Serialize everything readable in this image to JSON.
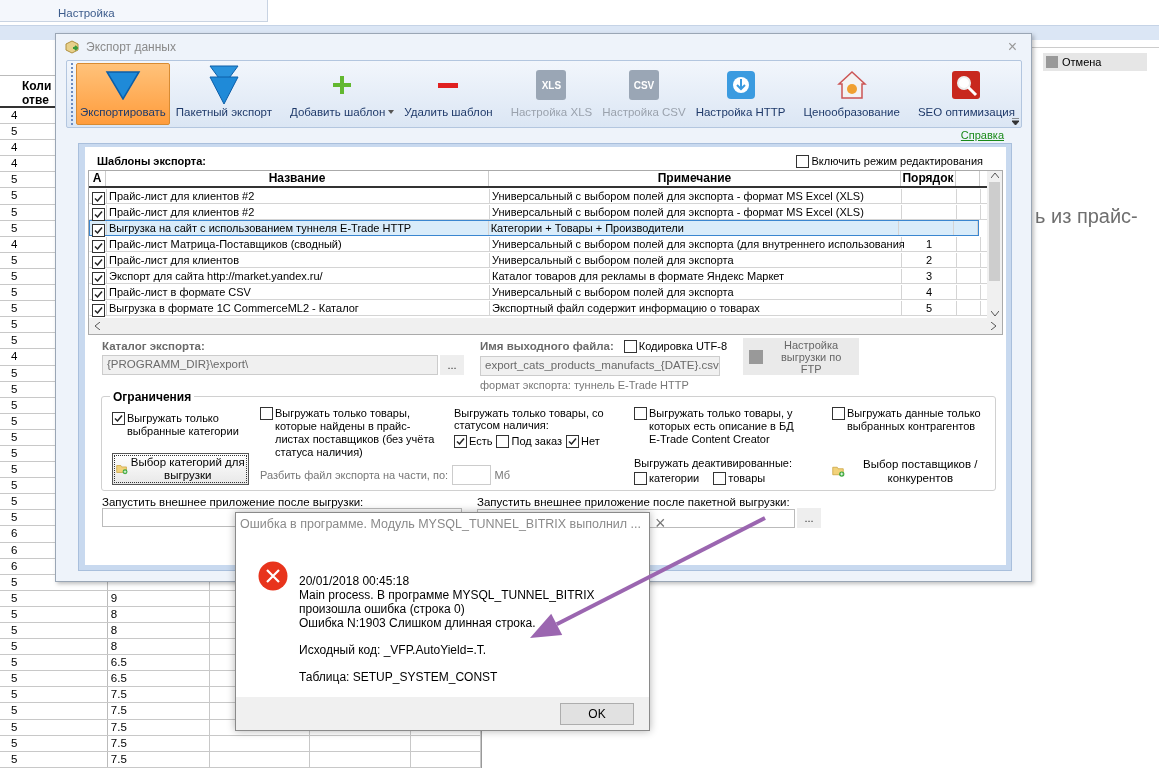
{
  "background_app": {
    "ribbon_group": "Настройка",
    "grid": {
      "header": "Коли отве",
      "rows": [
        {
          "column_1": "4"
        },
        {
          "column_1": "5"
        },
        {
          "column_1": "4"
        },
        {
          "column_1": "4"
        },
        {
          "column_1": "5"
        },
        {
          "column_1": "5"
        },
        {
          "column_1": "5"
        },
        {
          "column_1": "5"
        },
        {
          "column_1": "4"
        },
        {
          "column_1": "5"
        },
        {
          "column_1": "5"
        },
        {
          "column_1": "5"
        },
        {
          "column_1": "5"
        },
        {
          "column_1": "5"
        },
        {
          "column_1": "5"
        },
        {
          "column_1": "4"
        },
        {
          "column_1": "5"
        },
        {
          "column_1": "5"
        },
        {
          "column_1": "5"
        },
        {
          "column_1": "5"
        },
        {
          "column_1": "5"
        },
        {
          "column_1": "5"
        },
        {
          "column_1": "5"
        },
        {
          "column_1": "5"
        },
        {
          "column_1": "5"
        },
        {
          "column_1": "5"
        },
        {
          "column_1": "6"
        },
        {
          "column_1": "6"
        },
        {
          "column_1": "6"
        },
        {
          "column_1": "5"
        },
        {
          "column_1": "5",
          "column_2": "9"
        },
        {
          "column_1": "5",
          "column_2": "8"
        },
        {
          "column_1": "5",
          "column_2": "8"
        },
        {
          "column_1": "5",
          "column_2": "8"
        },
        {
          "column_1": "5",
          "column_2": "6.5"
        },
        {
          "column_1": "5",
          "column_2": "6.5"
        },
        {
          "column_1": "5",
          "column_2": "7.5"
        },
        {
          "column_1": "5",
          "column_2": "7.5"
        },
        {
          "column_1": "5",
          "column_2": "7.5"
        },
        {
          "column_1": "5",
          "column_2": "7.5"
        },
        {
          "column_1": "5",
          "column_2": "7.5"
        }
      ]
    },
    "cancel_button": "Отмена",
    "side_text": "ь из прайс-"
  },
  "export_window": {
    "title": "Экспорт данных",
    "close": "×",
    "toolbar": {
      "groups": [
        [
          {
            "label": "Экспортировать",
            "selected": true,
            "disabled": false
          },
          {
            "label": "Пакетный экспорт",
            "selected": false,
            "disabled": false
          }
        ],
        [
          {
            "label": "Добавить шаблон",
            "selected": false,
            "disabled": false,
            "dropdown": true
          },
          {
            "label": "Удалить шаблон",
            "selected": false,
            "disabled": false
          }
        ],
        [
          {
            "label": "Настройка XLS",
            "icon_text": "XLS",
            "selected": false,
            "disabled": true
          },
          {
            "label": "Настройка CSV",
            "icon_text": "CSV",
            "selected": false,
            "disabled": true
          },
          {
            "label": "Настройка HTTP",
            "selected": false,
            "disabled": false
          }
        ],
        [
          {
            "label": "Ценообразование",
            "selected": false,
            "disabled": false
          }
        ],
        [
          {
            "label": "SEO оптимизация",
            "selected": false,
            "disabled": false
          }
        ]
      ]
    },
    "help_link": "Справка",
    "templates": {
      "title": "Шаблоны экспорта:",
      "edit_mode": {
        "label": "Включить режим редактирования",
        "checked": false
      },
      "columns": [
        "А",
        "Название",
        "Примечание",
        "Порядок"
      ],
      "rows": [
        {
          "active": true,
          "name": "Прайс-лист для клиентов #2",
          "note": "Универсальный с выбором полей для экспорта - формат MS Excel (XLS)",
          "selected": false
        },
        {
          "active": true,
          "name": "Прайс-лист для клиентов #2",
          "note": "Универсальный с выбором полей для экспорта - формат MS Excel (XLS)",
          "selected": false
        },
        {
          "active": true,
          "name": "Выгрузка на сайт с использованием туннеля E-Trade HTTP",
          "note": "Категории + Товары + Производители",
          "selected": true
        },
        {
          "active": true,
          "name": "Прайс-лист Матрица-Поставщиков (сводный)",
          "note": "Универсальный с выбором полей для экспорта (для внутреннего использования",
          "order": "1",
          "selected": false
        },
        {
          "active": true,
          "name": "Прайс-лист для клиентов",
          "note": "Универсальный с выбором полей для экспорта",
          "order": "2",
          "selected": false
        },
        {
          "active": true,
          "name": "Экспорт для сайта http://market.yandex.ru/",
          "note": "Каталог товаров для рекламы в формате Яндекс Маркет",
          "order": "3",
          "selected": false
        },
        {
          "active": true,
          "name": "Прайс-лист в формате CSV",
          "note": "Универсальный с выбором полей для экспорта",
          "order": "4",
          "selected": false
        },
        {
          "active": true,
          "name": "Выгрузка в формате 1С CommerceML2 - Каталог",
          "note": "Экспортный файл содержит информацию о товарах",
          "order": "5",
          "selected": false
        }
      ]
    },
    "export_dir": {
      "label": "Каталог экспорта:",
      "value": "{PROGRAMM_DIR}\\export\\",
      "browse": "...",
      "disabled": true
    },
    "output_file": {
      "label": "Имя выходного файла:",
      "value": "export_cats_products_manufacts_{DATE}.csv",
      "disabled": true,
      "hint": "формат экспорта: туннель E-Trade HTTP"
    },
    "utf8": {
      "label": "Кодировка UTF-8",
      "checked": false
    },
    "ftp_button": {
      "label": "Настройка выгрузки по FTP",
      "disabled": true
    },
    "restrictions": {
      "title": "Ограничения",
      "selected_categories": {
        "label": "Выгружать только выбранные категории",
        "checked": true
      },
      "categories_button": "Выбор категорий для выгрузки",
      "supplier_found": {
        "label": "Выгружать только товары, которые найдены в прайс-листах поставщиков (без учёта статуса наличия)",
        "checked": false
      },
      "split_label": "Разбить файл экспорта на части, по:",
      "split_unit": "Мб",
      "status_label": "Выгружать только товары, со статусом наличия:",
      "statuses": [
        {
          "label": "Есть",
          "checked": true
        },
        {
          "label": "Под заказ",
          "checked": false
        },
        {
          "label": "Нет",
          "checked": true
        }
      ],
      "with_description": {
        "label": "Выгружать только товары, у которых есть описание в БД E-Trade Content Creator",
        "checked": false
      },
      "deactivated_label": "Выгружать деактивированные:",
      "deactivated": [
        {
          "label": "категории",
          "checked": false
        },
        {
          "label": "товары",
          "checked": false
        }
      ],
      "selected_partners": {
        "label": "Выгружать данные только выбранных контрагентов",
        "checked": false
      },
      "suppliers_button": "Выбор поставщиков / конкурентов"
    },
    "run_after": {
      "label": "Запустить внешнее приложение после выгрузки:"
    },
    "run_after_batch": {
      "label": "Запустить внешнее приложение после пакетной выгрузки:",
      "browse": "..."
    }
  },
  "error_dialog": {
    "title": "Ошибка в программе. Модуль MYSQL_TUNNEL_BITRIX выполнил ...",
    "close": "×",
    "paragraphs": [
      [
        "20/01/2018 00:45:18",
        "Main process. В программе MYSQL_TUNNEL_BITRIX",
        "произошла ошибка (строка 0)",
        "Ошибка N:1903 Слишком длинная строка."
      ],
      [
        "Исходный код: _VFP.AutoYield=.T."
      ],
      [
        "Таблица: SETUP_SYSTEM_CONST"
      ]
    ],
    "ok_button": "OK"
  }
}
